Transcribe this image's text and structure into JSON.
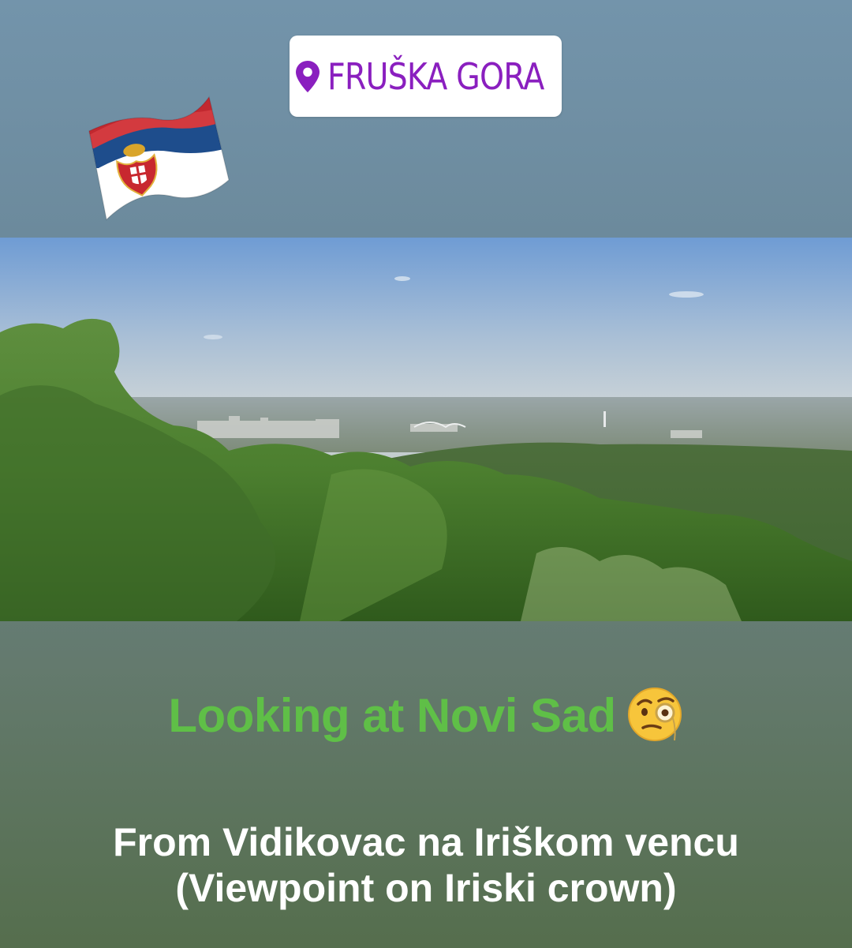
{
  "location_sticker": {
    "icon": "location-pin-icon",
    "text": "FRUŠKA GORA",
    "color": "#8a1fbf"
  },
  "flag_sticker": {
    "icon": "serbia-flag-icon",
    "colors": [
      "#c6363c",
      "#0c4076",
      "#ffffff"
    ]
  },
  "photo": {
    "subject": "landscape-photo"
  },
  "caption": {
    "main": "Looking at Novi Sad",
    "main_emoji": "face-with-monocle-icon",
    "main_color": "#5fbf47",
    "sub_line1": "From Vidikovac na Iriškom vencu",
    "sub_line2": "(Viewpoint on Iriski crown)"
  }
}
